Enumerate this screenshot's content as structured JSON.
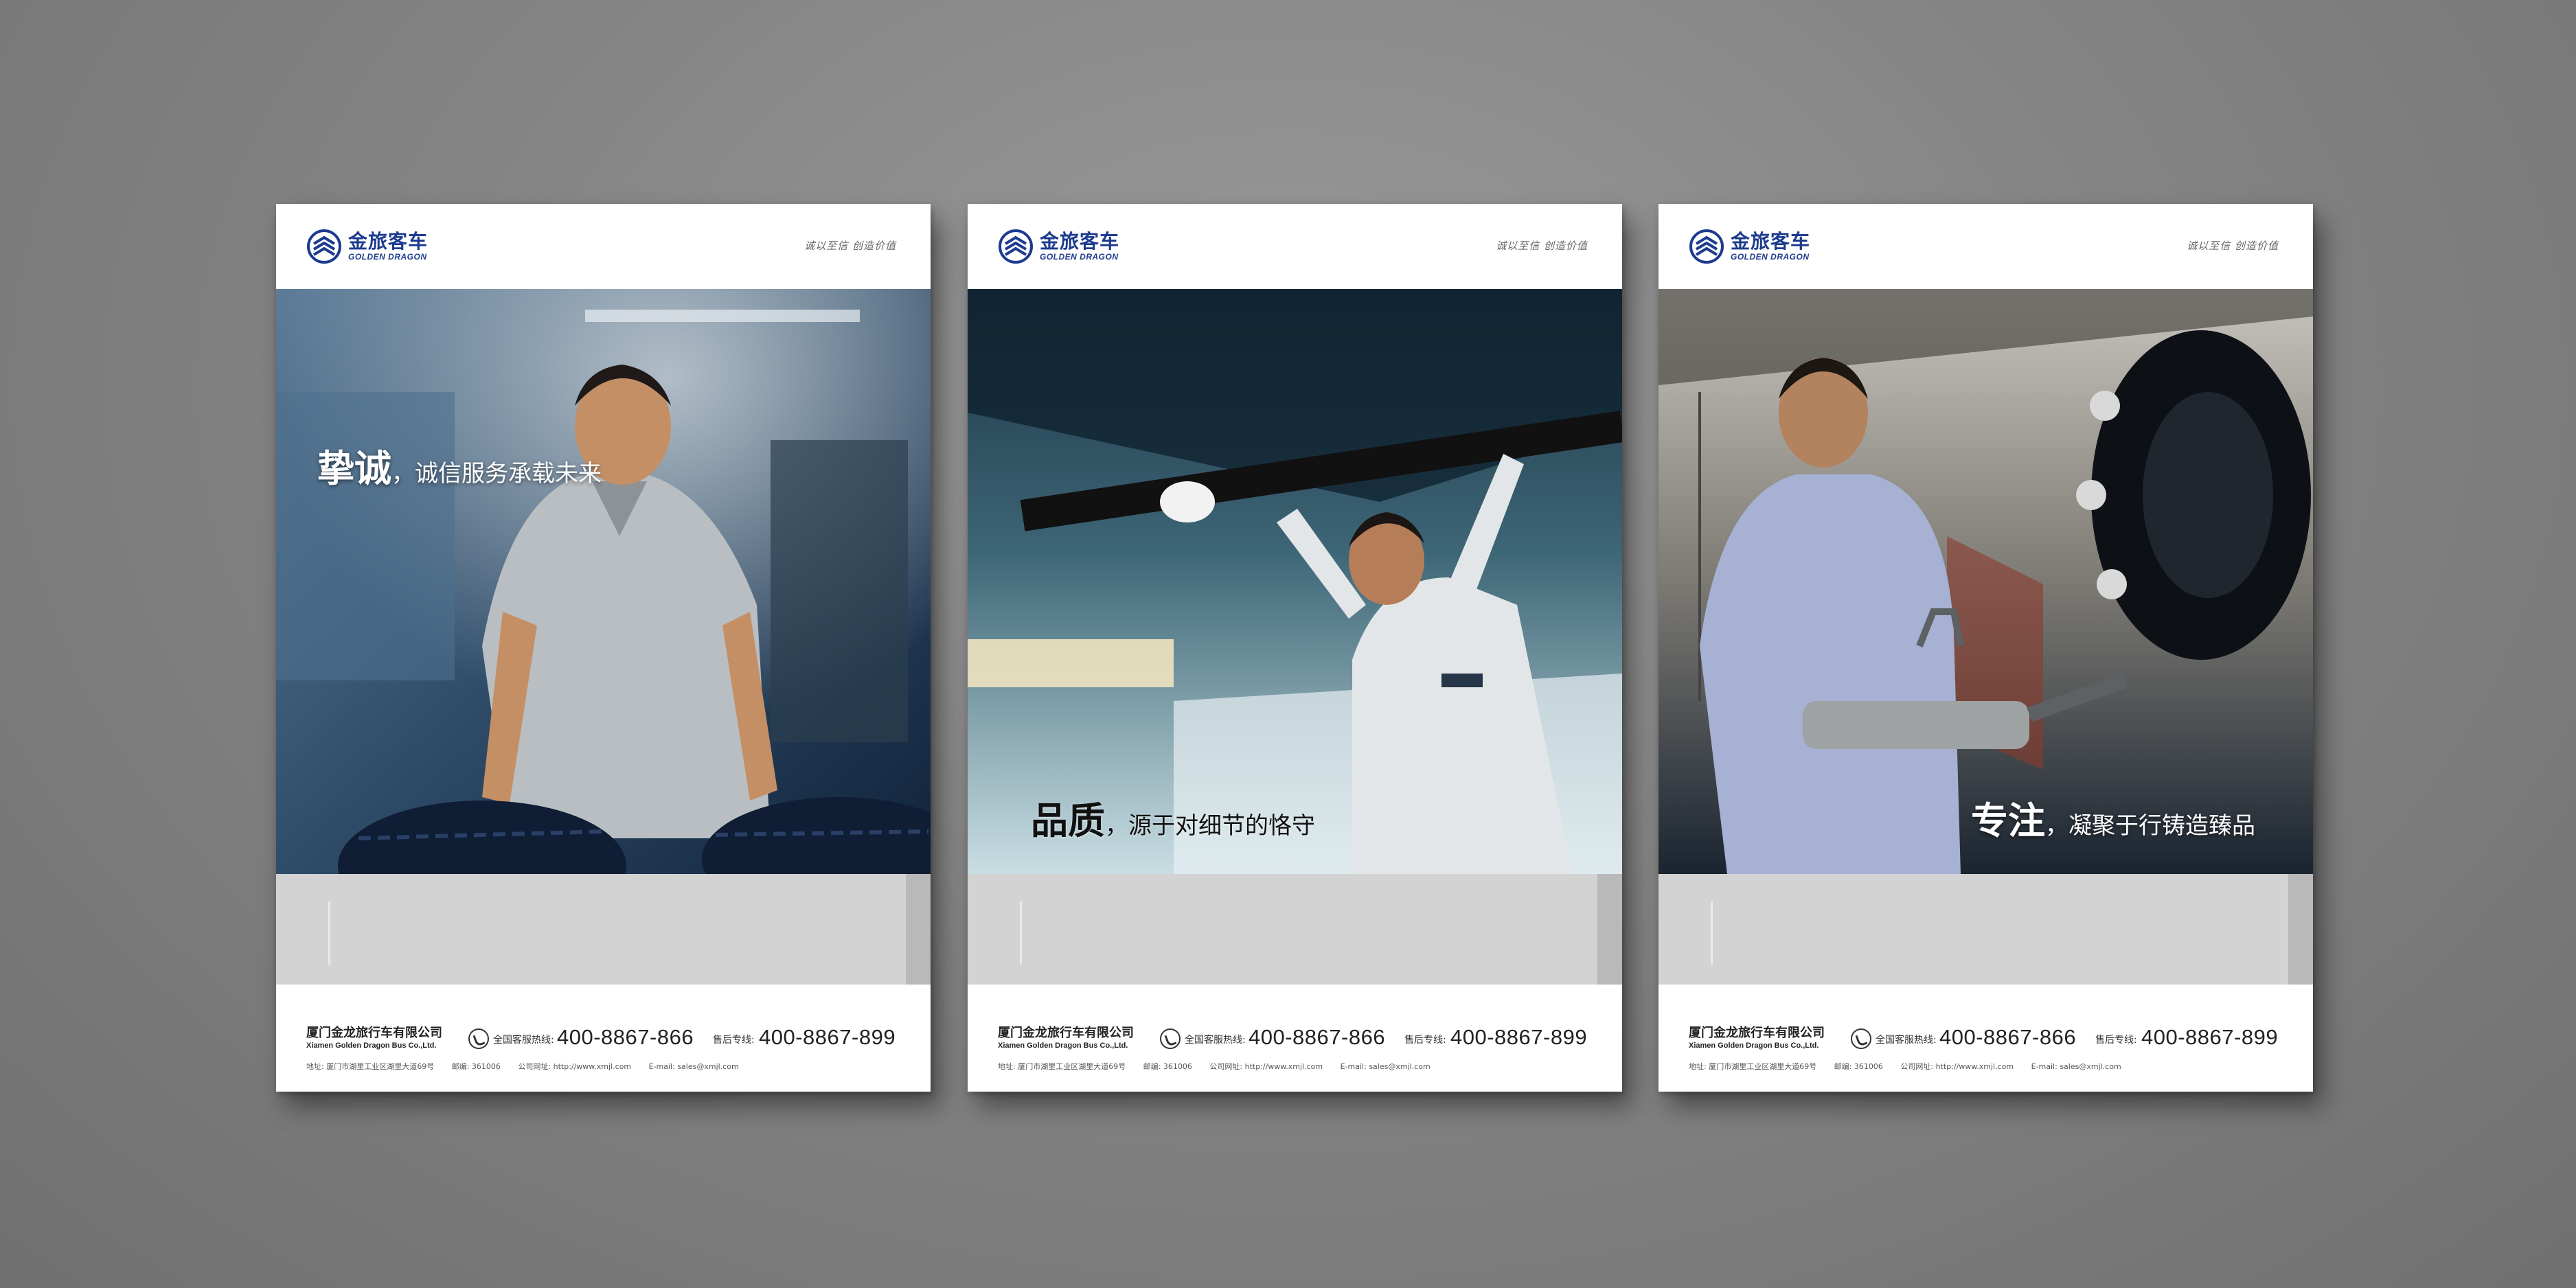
{
  "brand": {
    "name_cn": "金旅客车",
    "name_en": "GOLDEN DRAGON",
    "logo": "golden-dragon-chevron-logo",
    "color": "#1d3b8e"
  },
  "slogan": "诚以至信   创造价值",
  "posters": [
    {
      "headline_big": "挚诚",
      "headline_rest": "，诚信服务承载未来",
      "photo": "smiling worker in gray shirt holding tires in a blue-toned factory",
      "body_text": ""
    },
    {
      "headline_big": "品质",
      "headline_rest": "，源于对细节的恪守",
      "photo": "technician working under a bus chassis with raised arms",
      "body_text": ""
    },
    {
      "headline_big": "专注",
      "headline_rest": "，凝聚于行铸造臻品",
      "photo": "worker operating an impact wrench on a wheel hub in a workshop",
      "body_text": ""
    }
  ],
  "footer": {
    "company_cn": "厦门金龙旅行车有限公司",
    "company_en": "Xiamen Golden Dragon Bus Co.,Ltd.",
    "hotline_label": "全国客服热线:",
    "hotline_number": "400-8867-866",
    "after_sales_label": "售后专线:",
    "after_sales_number": "400-8867-899",
    "address": "地址: 厦门市湖里工业区湖里大道69号",
    "postcode": "邮编: 361006",
    "website": "公司网址: http://www.xmjl.com",
    "email": "E-mail: sales@xmjl.com"
  },
  "colors": {
    "background": "#808080",
    "band": "#d3d3d3",
    "brand_blue": "#1d3b8e"
  }
}
